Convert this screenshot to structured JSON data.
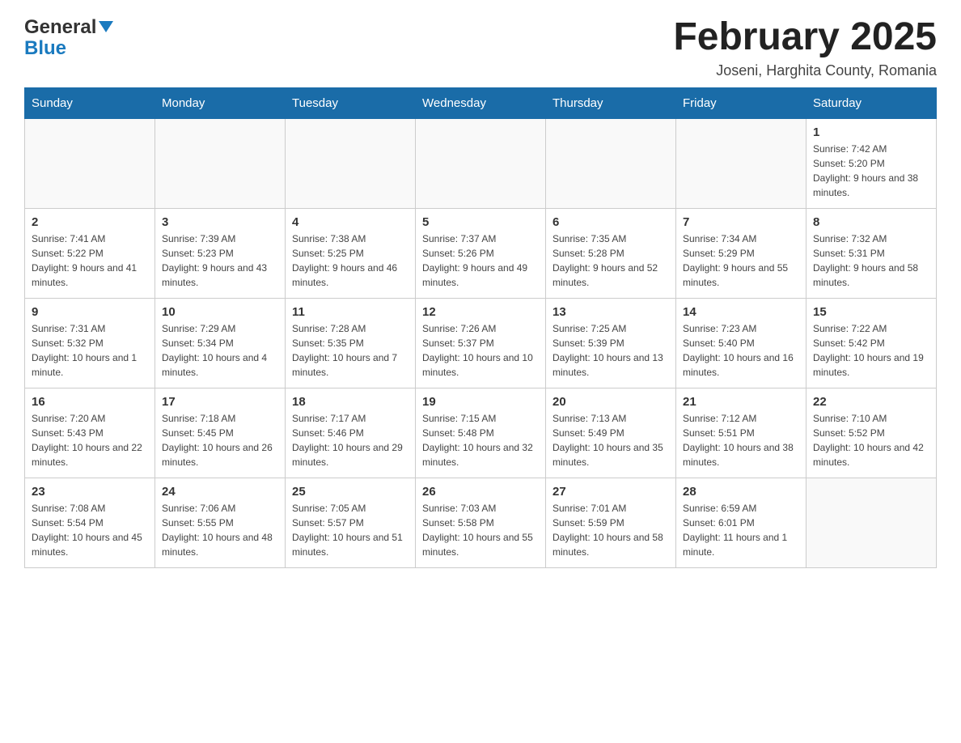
{
  "logo": {
    "general": "General",
    "blue": "Blue"
  },
  "header": {
    "title": "February 2025",
    "location": "Joseni, Harghita County, Romania"
  },
  "weekdays": [
    "Sunday",
    "Monday",
    "Tuesday",
    "Wednesday",
    "Thursday",
    "Friday",
    "Saturday"
  ],
  "weeks": [
    [
      {
        "day": "",
        "info": ""
      },
      {
        "day": "",
        "info": ""
      },
      {
        "day": "",
        "info": ""
      },
      {
        "day": "",
        "info": ""
      },
      {
        "day": "",
        "info": ""
      },
      {
        "day": "",
        "info": ""
      },
      {
        "day": "1",
        "info": "Sunrise: 7:42 AM\nSunset: 5:20 PM\nDaylight: 9 hours and 38 minutes."
      }
    ],
    [
      {
        "day": "2",
        "info": "Sunrise: 7:41 AM\nSunset: 5:22 PM\nDaylight: 9 hours and 41 minutes."
      },
      {
        "day": "3",
        "info": "Sunrise: 7:39 AM\nSunset: 5:23 PM\nDaylight: 9 hours and 43 minutes."
      },
      {
        "day": "4",
        "info": "Sunrise: 7:38 AM\nSunset: 5:25 PM\nDaylight: 9 hours and 46 minutes."
      },
      {
        "day": "5",
        "info": "Sunrise: 7:37 AM\nSunset: 5:26 PM\nDaylight: 9 hours and 49 minutes."
      },
      {
        "day": "6",
        "info": "Sunrise: 7:35 AM\nSunset: 5:28 PM\nDaylight: 9 hours and 52 minutes."
      },
      {
        "day": "7",
        "info": "Sunrise: 7:34 AM\nSunset: 5:29 PM\nDaylight: 9 hours and 55 minutes."
      },
      {
        "day": "8",
        "info": "Sunrise: 7:32 AM\nSunset: 5:31 PM\nDaylight: 9 hours and 58 minutes."
      }
    ],
    [
      {
        "day": "9",
        "info": "Sunrise: 7:31 AM\nSunset: 5:32 PM\nDaylight: 10 hours and 1 minute."
      },
      {
        "day": "10",
        "info": "Sunrise: 7:29 AM\nSunset: 5:34 PM\nDaylight: 10 hours and 4 minutes."
      },
      {
        "day": "11",
        "info": "Sunrise: 7:28 AM\nSunset: 5:35 PM\nDaylight: 10 hours and 7 minutes."
      },
      {
        "day": "12",
        "info": "Sunrise: 7:26 AM\nSunset: 5:37 PM\nDaylight: 10 hours and 10 minutes."
      },
      {
        "day": "13",
        "info": "Sunrise: 7:25 AM\nSunset: 5:39 PM\nDaylight: 10 hours and 13 minutes."
      },
      {
        "day": "14",
        "info": "Sunrise: 7:23 AM\nSunset: 5:40 PM\nDaylight: 10 hours and 16 minutes."
      },
      {
        "day": "15",
        "info": "Sunrise: 7:22 AM\nSunset: 5:42 PM\nDaylight: 10 hours and 19 minutes."
      }
    ],
    [
      {
        "day": "16",
        "info": "Sunrise: 7:20 AM\nSunset: 5:43 PM\nDaylight: 10 hours and 22 minutes."
      },
      {
        "day": "17",
        "info": "Sunrise: 7:18 AM\nSunset: 5:45 PM\nDaylight: 10 hours and 26 minutes."
      },
      {
        "day": "18",
        "info": "Sunrise: 7:17 AM\nSunset: 5:46 PM\nDaylight: 10 hours and 29 minutes."
      },
      {
        "day": "19",
        "info": "Sunrise: 7:15 AM\nSunset: 5:48 PM\nDaylight: 10 hours and 32 minutes."
      },
      {
        "day": "20",
        "info": "Sunrise: 7:13 AM\nSunset: 5:49 PM\nDaylight: 10 hours and 35 minutes."
      },
      {
        "day": "21",
        "info": "Sunrise: 7:12 AM\nSunset: 5:51 PM\nDaylight: 10 hours and 38 minutes."
      },
      {
        "day": "22",
        "info": "Sunrise: 7:10 AM\nSunset: 5:52 PM\nDaylight: 10 hours and 42 minutes."
      }
    ],
    [
      {
        "day": "23",
        "info": "Sunrise: 7:08 AM\nSunset: 5:54 PM\nDaylight: 10 hours and 45 minutes."
      },
      {
        "day": "24",
        "info": "Sunrise: 7:06 AM\nSunset: 5:55 PM\nDaylight: 10 hours and 48 minutes."
      },
      {
        "day": "25",
        "info": "Sunrise: 7:05 AM\nSunset: 5:57 PM\nDaylight: 10 hours and 51 minutes."
      },
      {
        "day": "26",
        "info": "Sunrise: 7:03 AM\nSunset: 5:58 PM\nDaylight: 10 hours and 55 minutes."
      },
      {
        "day": "27",
        "info": "Sunrise: 7:01 AM\nSunset: 5:59 PM\nDaylight: 10 hours and 58 minutes."
      },
      {
        "day": "28",
        "info": "Sunrise: 6:59 AM\nSunset: 6:01 PM\nDaylight: 11 hours and 1 minute."
      },
      {
        "day": "",
        "info": ""
      }
    ]
  ]
}
